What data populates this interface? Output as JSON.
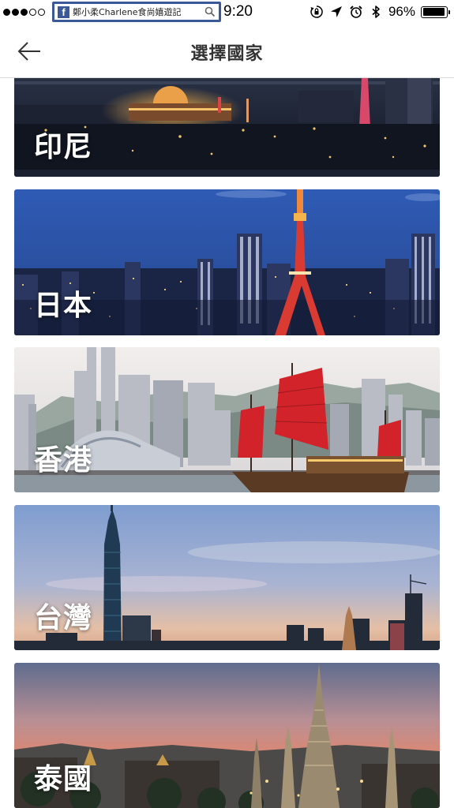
{
  "status_bar": {
    "signal_dots": 5,
    "signal_strength": 3,
    "fb_banner_text": "鄭小柔Charlene食尚嬉遊記",
    "time": "9:20",
    "battery_percent": "96%",
    "battery_level": 0.96,
    "icons": [
      "fb-logo-icon",
      "search-icon",
      "rotation-lock-icon",
      "location-arrow-icon",
      "alarm-icon",
      "bluetooth-icon",
      "battery-icon"
    ]
  },
  "nav": {
    "title": "選擇國家",
    "back_icon": "arrow-left-icon"
  },
  "countries": [
    {
      "id": "indonesia",
      "label": "印尼",
      "image": "night city skyline with lit dome and red tower"
    },
    {
      "id": "japan",
      "label": "日本",
      "image": "Tokyo skyline at dusk with Tokyo Tower"
    },
    {
      "id": "hongkong",
      "label": "香港",
      "image": "Victoria Harbour with red-sailed junk"
    },
    {
      "id": "taiwan",
      "label": "台灣",
      "image": "Taipei skyline with Taipei 101 at dusk"
    },
    {
      "id": "thailand",
      "label": "泰國",
      "image": "Wat Arun temple at sunset"
    }
  ],
  "colors": {
    "facebook": "#3b5998",
    "title_text": "#333333",
    "label_text": "#ffffff",
    "divider": "#dcdcdc"
  }
}
